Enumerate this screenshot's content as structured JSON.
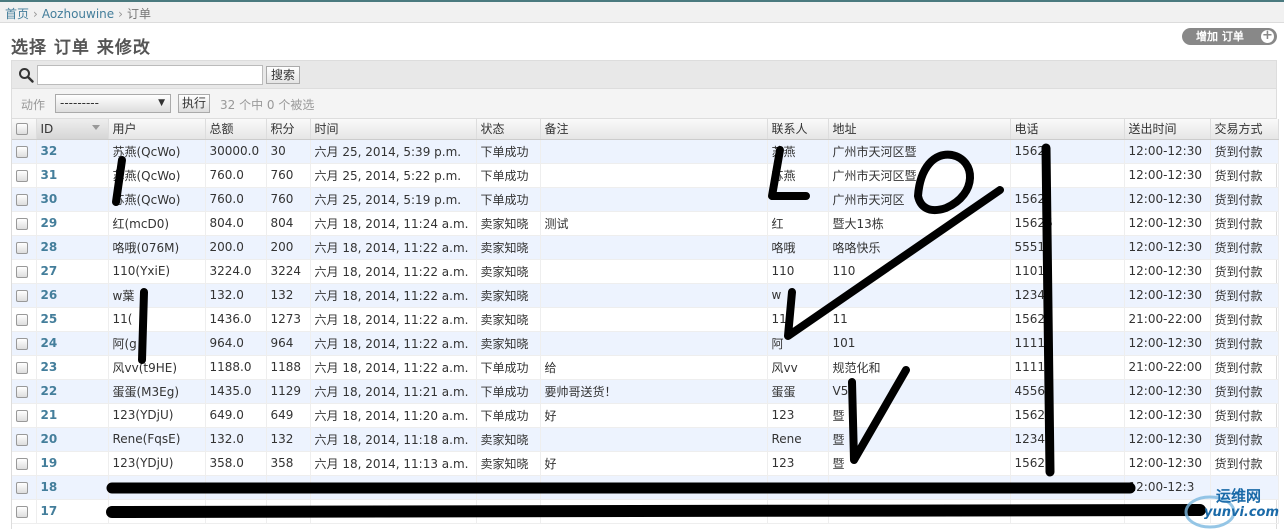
{
  "breadcrumbs": {
    "home": "首页",
    "app": "Aozhouwine",
    "current": "订单",
    "separator": "›"
  },
  "page": {
    "title": "选择 订单 来修改"
  },
  "add_button": {
    "label": "增加 订单",
    "plus": "+"
  },
  "search": {
    "value": "",
    "placeholder": "",
    "button": "搜索"
  },
  "actions": {
    "label": "动作",
    "selected": "---------",
    "go": "执行",
    "count": "32 个中 0 个被选"
  },
  "columns": [
    "ID",
    "用户",
    "总额",
    "积分",
    "时间",
    "状态",
    "备注",
    "联系人",
    "地址",
    "电话",
    "送出时间",
    "交易方式"
  ],
  "rows": [
    {
      "id": "32",
      "user": "苏燕(QcWo)",
      "total": "30000.0",
      "points": "30",
      "time": "六月 25, 2014, 5:39 p.m.",
      "status": "下单成功",
      "note": "",
      "contact": "苏燕",
      "address": "广州市天河区暨",
      "phone": "1562",
      "send": "12:00-12:30",
      "pay": "货到付款"
    },
    {
      "id": "31",
      "user": "苏燕(QcWo)",
      "total": "760.0",
      "points": "760",
      "time": "六月 25, 2014, 5:22 p.m.",
      "status": "下单成功",
      "note": "",
      "contact": "苏燕",
      "address": "广州市天河区暨",
      "phone": "",
      "send": "12:00-12:30",
      "pay": "货到付款"
    },
    {
      "id": "30",
      "user": "苏燕(QcWo)",
      "total": "760.0",
      "points": "760",
      "time": "六月 25, 2014, 5:19 p.m.",
      "status": "下单成功",
      "note": "",
      "contact": "",
      "address": "广州市天河区",
      "phone": "1562",
      "send": "12:00-12:30",
      "pay": "货到付款"
    },
    {
      "id": "29",
      "user": "红(mcD0)",
      "total": "804.0",
      "points": "804",
      "time": "六月 18, 2014, 11:24 a.m.",
      "status": "卖家知晓",
      "note": "测试",
      "contact": "红",
      "address": "暨大13栋",
      "phone": "15626",
      "send": "12:00-12:30",
      "pay": "货到付款"
    },
    {
      "id": "28",
      "user": "咯哦(076M)",
      "total": "200.0",
      "points": "200",
      "time": "六月 18, 2014, 11:22 a.m.",
      "status": "卖家知晓",
      "note": "",
      "contact": "咯哦",
      "address": "咯咯快乐",
      "phone": "55512",
      "send": "12:00-12:30",
      "pay": "货到付款"
    },
    {
      "id": "27",
      "user": "110(YxiE)",
      "total": "3224.0",
      "points": "3224",
      "time": "六月 18, 2014, 11:22 a.m.",
      "status": "卖家知晓",
      "note": "",
      "contact": "110",
      "address": "110",
      "phone": "1101",
      "send": "12:00-12:30",
      "pay": "货到付款"
    },
    {
      "id": "26",
      "user": "w葉",
      "total": "132.0",
      "points": "132",
      "time": "六月 18, 2014, 11:22 a.m.",
      "status": "卖家知晓",
      "note": "",
      "contact": "w",
      "address": "",
      "phone": "1234",
      "send": "12:00-12:30",
      "pay": "货到付款"
    },
    {
      "id": "25",
      "user": "11(",
      "total": "1436.0",
      "points": "1273",
      "time": "六月 18, 2014, 11:22 a.m.",
      "status": "卖家知晓",
      "note": "",
      "contact": "11",
      "address": "11",
      "phone": "1562",
      "send": "21:00-22:00",
      "pay": "货到付款"
    },
    {
      "id": "24",
      "user": "阿(g",
      "total": "964.0",
      "points": "964",
      "time": "六月 18, 2014, 11:22 a.m.",
      "status": "卖家知晓",
      "note": "",
      "contact": "阿",
      "address": "101",
      "phone": "1111",
      "send": "12:00-12:30",
      "pay": "货到付款"
    },
    {
      "id": "23",
      "user": "风vv(t9HE)",
      "total": "1188.0",
      "points": "1188",
      "time": "六月 18, 2014, 11:22 a.m.",
      "status": "下单成功",
      "note": "给",
      "contact": "风vv",
      "address": "规范化和",
      "phone": "1111",
      "send": "21:00-22:00",
      "pay": "货到付款"
    },
    {
      "id": "22",
      "user": "蛋蛋(M3Eg)",
      "total": "1435.0",
      "points": "1129",
      "time": "六月 18, 2014, 11:21 a.m.",
      "status": "下单成功",
      "note": "要帅哥送货！",
      "contact": "蛋蛋",
      "address": "V5",
      "phone": "4556",
      "send": "12:00-12:30",
      "pay": "货到付款"
    },
    {
      "id": "21",
      "user": "123(YDjU)",
      "total": "649.0",
      "points": "649",
      "time": "六月 18, 2014, 11:20 a.m.",
      "status": "下单成功",
      "note": "好",
      "contact": "123",
      "address": "暨",
      "phone": "1562",
      "send": "12:00-12:30",
      "pay": "货到付款"
    },
    {
      "id": "20",
      "user": "Rene(FqsE)",
      "total": "132.0",
      "points": "132",
      "time": "六月 18, 2014, 11:18 a.m.",
      "status": "卖家知晓",
      "note": "",
      "contact": "Rene",
      "address": "暨",
      "phone": "1234",
      "send": "12:00-12:30",
      "pay": "货到付款"
    },
    {
      "id": "19",
      "user": "123(YDjU)",
      "total": "358.0",
      "points": "358",
      "time": "六月 18, 2014, 11:13 a.m.",
      "status": "卖家知晓",
      "note": "好",
      "contact": "123",
      "address": "暨",
      "phone": "15626",
      "send": "12:00-12:30",
      "pay": "货到付款"
    },
    {
      "id": "18",
      "user": "",
      "total": "",
      "points": "",
      "time": "",
      "status": "",
      "note": "",
      "contact": "",
      "address": "",
      "phone": "",
      "send": "12:00-12:3",
      "pay": ""
    },
    {
      "id": "17",
      "user": "",
      "total": "",
      "points": "",
      "time": "",
      "status": "",
      "note": "",
      "contact": "",
      "address": "",
      "phone": "",
      "send": "",
      "pay": ""
    }
  ],
  "watermark": {
    "line1": "运维网",
    "line2": "yunvi.com"
  },
  "colors": {
    "link": "#447e9b",
    "alt_row": "#edf3fe",
    "ink": "#000000"
  }
}
